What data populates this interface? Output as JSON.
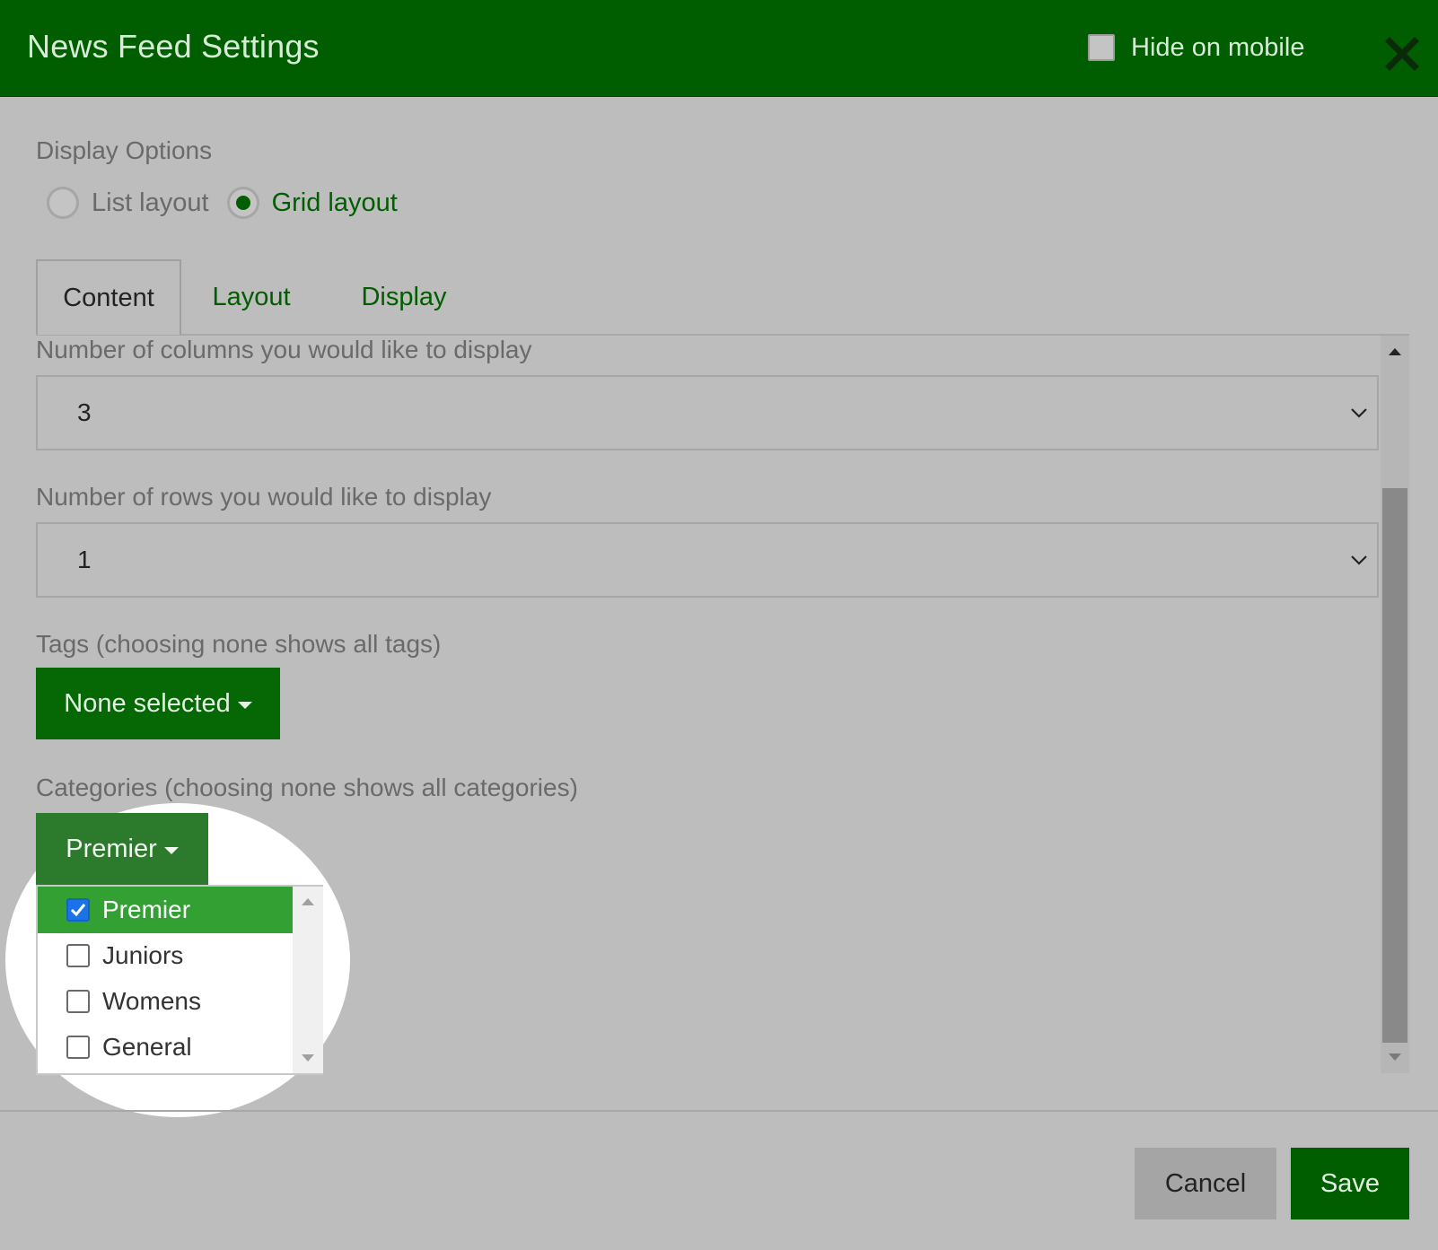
{
  "header": {
    "title": "News Feed Settings",
    "hide_on_mobile_label": "Hide on mobile",
    "hide_on_mobile_checked": false,
    "close_icon": "close-icon"
  },
  "display_options": {
    "label": "Display Options",
    "options": [
      {
        "label": "List layout",
        "selected": false
      },
      {
        "label": "Grid layout",
        "selected": true
      }
    ]
  },
  "tabs": [
    {
      "label": "Content",
      "active": true
    },
    {
      "label": "Layout",
      "active": false
    },
    {
      "label": "Display",
      "active": false
    }
  ],
  "content": {
    "columns": {
      "label": "Number of columns you would like to display",
      "value": "3"
    },
    "rows": {
      "label": "Number of rows you would like to display",
      "value": "1"
    },
    "tags": {
      "label": "Tags (choosing none shows all tags)",
      "button_label": "None selected"
    },
    "categories": {
      "label": "Categories (choosing none shows all categories)",
      "button_label": "Premier",
      "options": [
        {
          "label": "Premier",
          "checked": true
        },
        {
          "label": "Juniors",
          "checked": false
        },
        {
          "label": "Womens",
          "checked": false
        },
        {
          "label": "General",
          "checked": false
        }
      ]
    }
  },
  "footer": {
    "cancel_label": "Cancel",
    "save_label": "Save"
  },
  "colors": {
    "brand_green": "#005e00",
    "selected_item_green": "#32a032",
    "overlay_gray": "#bdbdbd"
  }
}
